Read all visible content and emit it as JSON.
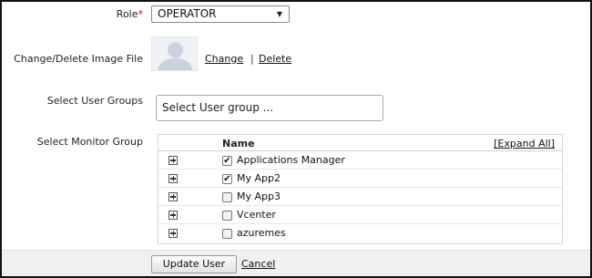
{
  "form": {
    "role_label": "Role",
    "role_required": "*",
    "role_value": "OPERATOR",
    "image_label": "Change/Delete Image File",
    "change_link": "Change",
    "separator": "|",
    "delete_link": "Delete",
    "groups_label": "Select User Groups",
    "groups_placeholder": "Select User group ...",
    "monitor_label": "Select Monitor Group"
  },
  "monitor_table": {
    "name_header": "Name",
    "expand_all": "[Expand All]",
    "rows": [
      {
        "name": "Applications Manager",
        "checked": true
      },
      {
        "name": "My App2",
        "checked": true
      },
      {
        "name": "My App3",
        "checked": false
      },
      {
        "name": "Vcenter",
        "checked": false
      },
      {
        "name": "azuremes",
        "checked": false
      }
    ]
  },
  "footer": {
    "update_button": "Update User",
    "cancel_link": "Cancel"
  },
  "icons": {
    "dropdown": "caret-down-icon",
    "avatar": "user-silhouette-icon",
    "expand": "plus-box-icon",
    "checkbox": "checkbox-icon"
  }
}
